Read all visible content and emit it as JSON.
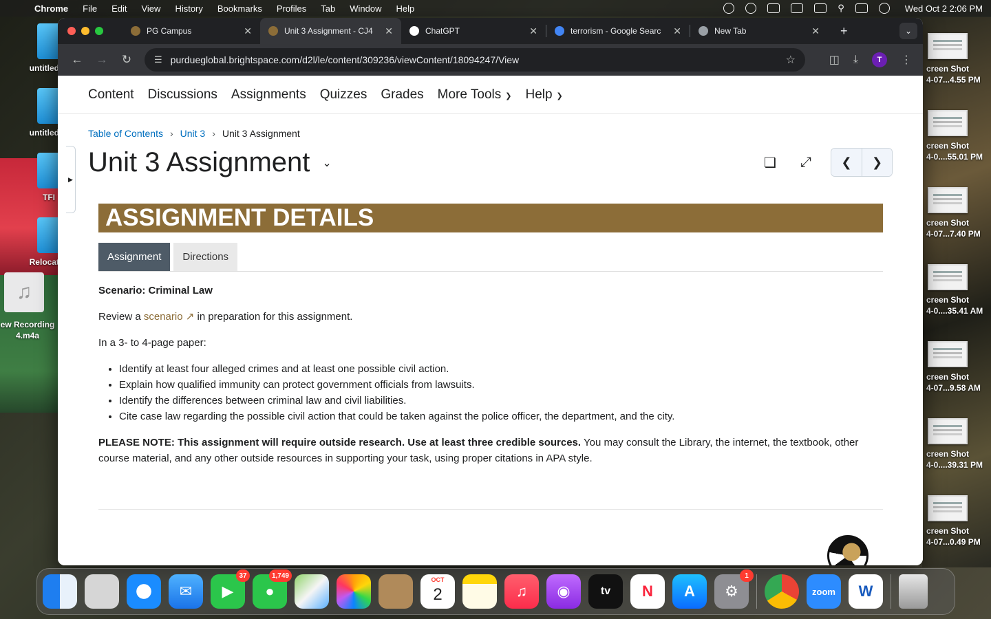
{
  "menubar": {
    "app_name": "Chrome",
    "items": [
      "File",
      "Edit",
      "View",
      "History",
      "Bookmarks",
      "Profiles",
      "Tab",
      "Window",
      "Help"
    ],
    "clock": "Wed Oct 2  2:06 PM"
  },
  "desktop_left": [
    {
      "label": "untitled"
    },
    {
      "label": "untitled"
    },
    {
      "label": "TFI"
    },
    {
      "label": "Relocat"
    }
  ],
  "desktop_music": {
    "label": "ew Recording 4.m4a"
  },
  "desktop_right": [
    {
      "line1": "creen Shot",
      "line2": "4-07...4.55 PM"
    },
    {
      "line1": "creen Shot",
      "line2": "4-0....55.01 PM"
    },
    {
      "line1": "creen Shot",
      "line2": "4-07...7.40 PM"
    },
    {
      "line1": "creen Shot",
      "line2": "4-0....35.41 AM"
    },
    {
      "line1": "creen Shot",
      "line2": "4-07...9.58 AM"
    },
    {
      "line1": "creen Shot",
      "line2": "4-0....39.31 PM"
    },
    {
      "line1": "creen Shot",
      "line2": "4-07...0.49 PM"
    }
  ],
  "browser": {
    "tabs": [
      {
        "title": "PG Campus",
        "active": false,
        "favicon_color": "#8c6d38"
      },
      {
        "title": "Unit 3 Assignment - CJ4",
        "active": true,
        "favicon_color": "#8c6d38"
      },
      {
        "title": "ChatGPT",
        "active": false,
        "favicon_color": "#ffffff"
      },
      {
        "title": "terrorism - Google Searc",
        "active": false,
        "favicon_color": "#4285f4"
      },
      {
        "title": "New Tab",
        "active": false,
        "favicon_color": "#9aa0a6"
      }
    ],
    "url": "purdueglobal.brightspace.com/d2l/le/content/309236/viewContent/18094247/View",
    "profile_initial": "T"
  },
  "nav": {
    "items": [
      "Content",
      "Discussions",
      "Assignments",
      "Quizzes",
      "Grades"
    ],
    "more_tools": "More Tools",
    "help": "Help"
  },
  "breadcrumbs": {
    "toc": "Table of Contents",
    "unit": "Unit 3",
    "current": "Unit 3 Assignment"
  },
  "page": {
    "title": "Unit 3 Assignment"
  },
  "assignment": {
    "banner": "ASSIGNMENT DETAILS",
    "tab_assignment": "Assignment",
    "tab_directions": "Directions",
    "scenario_heading": "Scenario: Criminal Law",
    "review_pre": "Review a ",
    "review_link": "scenario",
    "review_post": " in preparation for this assignment.",
    "paper_intro": "In a 3- to 4-page paper:",
    "bullets": [
      "Identify at least four alleged crimes and at least one possible civil action.",
      "Explain how qualified immunity can protect government officials from lawsuits.",
      "Identify the differences between criminal law and civil liabilities.",
      "Cite case law regarding the possible civil action that could be taken against the police officer, the department, and the city."
    ],
    "note_bold": "PLEASE NOTE: This assignment will require outside research. Use at least three credible sources.",
    "note_rest": " You may consult the Library, the internet, the textbook, other course material, and any other outside resources in supporting your task, using proper citations in APA style."
  },
  "dock": {
    "facetime_badge": "37",
    "messages_badge": "1,749",
    "calendar_month": "OCT",
    "calendar_day": "2",
    "settings_badge": "1",
    "zoom_label": "zoom",
    "word_label": "W"
  },
  "colors": {
    "accent_gold": "#8c6d38",
    "link_blue": "#006fbf",
    "tab_active": "#4e5b67"
  }
}
